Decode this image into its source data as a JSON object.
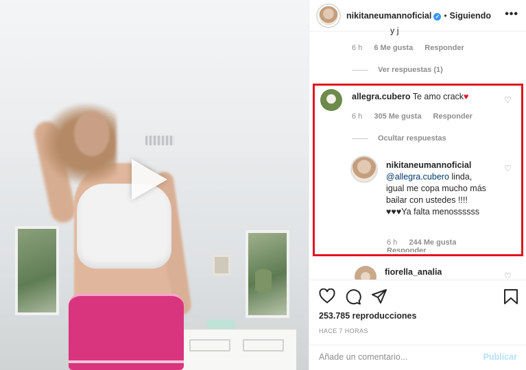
{
  "header": {
    "username": "nikitaneumannoficial",
    "follow_label": "Siguiendo",
    "more_label": "•••"
  },
  "comment_prev": {
    "partial_text": "y j",
    "time": "6 h",
    "likes": "6 Me gusta",
    "reply_label": "Responder",
    "view_replies": "Ver respuestas (1)"
  },
  "comment_main": {
    "username": "allegra.cubero",
    "text": "Te amo crack",
    "emoji": "♥",
    "time": "6 h",
    "likes": "305 Me gusta",
    "reply_label": "Responder",
    "hide_replies": "Ocultar respuestas"
  },
  "reply": {
    "username": "nikitaneumannoficial",
    "mention": "@allegra.cubero",
    "text": " linda, igual me copa mucho más bailar con ustedes !!!!♥♥♥Ya falta menossssss",
    "time": "6 h",
    "likes": "244 Me gusta",
    "reply_label": "Responder"
  },
  "comment_next": {
    "username": "fiorella_analia"
  },
  "actions": {
    "views": "253.785 reproducciones",
    "time_ago": "HACE 7 HORAS"
  },
  "add_comment": {
    "placeholder": "Añade un comentario...",
    "publish_label": "Publicar"
  },
  "colors": {
    "highlight": "#e0141f",
    "verified": "#3897f0",
    "publish": "#b2dffc"
  }
}
